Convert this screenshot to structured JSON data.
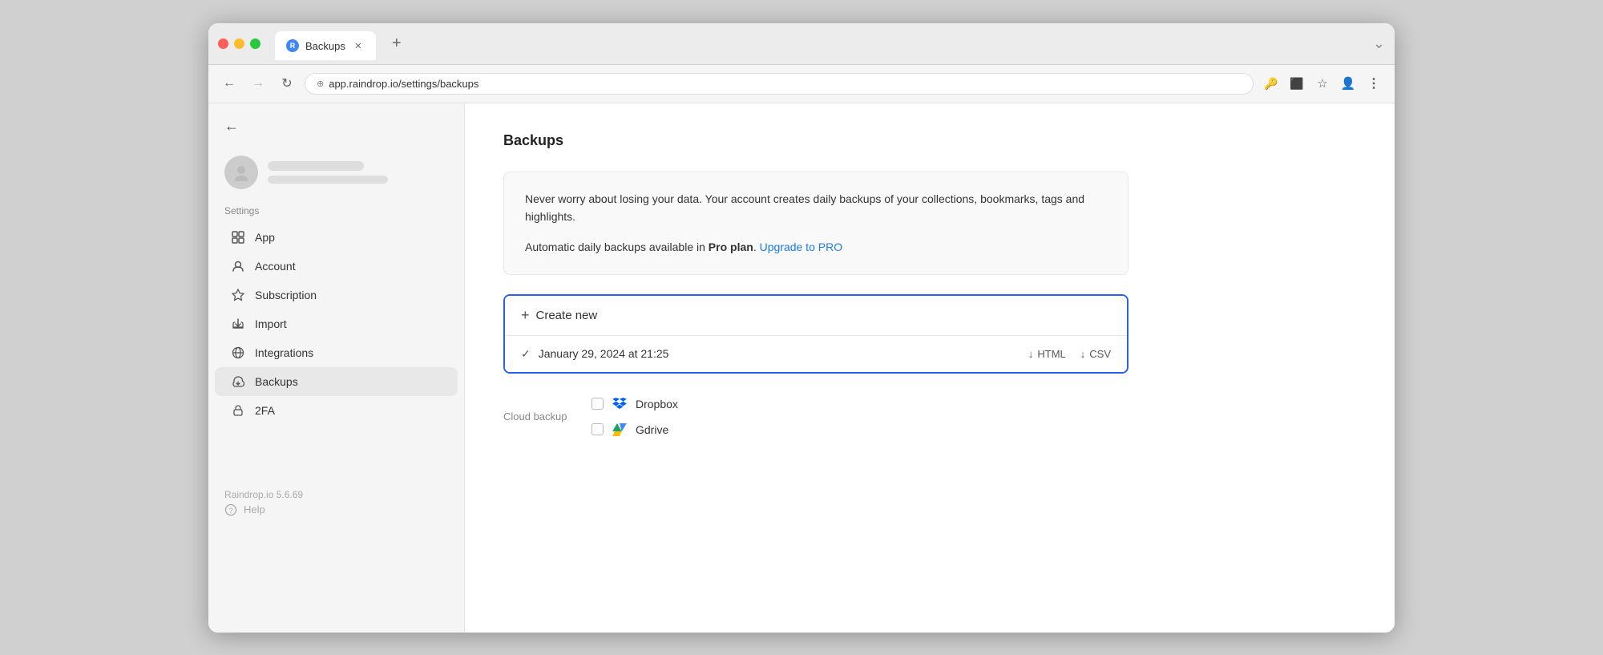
{
  "browser": {
    "tab_label": "Backups",
    "tab_favicon": "R",
    "url": "app.raindrop.io/settings/backups",
    "add_tab_label": "+",
    "chevron_down": "⌄"
  },
  "nav": {
    "back_arrow": "←",
    "forward_arrow": "→",
    "refresh": "↻"
  },
  "toolbar": {
    "keys_icon": "🔑",
    "cast_icon": "⬜",
    "star_icon": "☆",
    "profile_icon": "👤",
    "menu_icon": "⋮"
  },
  "sidebar": {
    "back_arrow": "←",
    "settings_label": "Settings",
    "items": [
      {
        "id": "app",
        "label": "App",
        "icon": "app"
      },
      {
        "id": "account",
        "label": "Account",
        "icon": "account"
      },
      {
        "id": "subscription",
        "label": "Subscription",
        "icon": "subscription"
      },
      {
        "id": "import",
        "label": "Import",
        "icon": "import"
      },
      {
        "id": "integrations",
        "label": "Integrations",
        "icon": "integrations"
      },
      {
        "id": "backups",
        "label": "Backups",
        "icon": "backups"
      },
      {
        "id": "2fa",
        "label": "2FA",
        "icon": "2fa"
      }
    ],
    "version": "Raindrop.io 5.6.69",
    "help_label": "Help"
  },
  "content": {
    "page_title": "Backups",
    "info_box": {
      "text1": "Never worry about losing your data. Your account creates daily backups of your collections, bookmarks, tags and highlights.",
      "text2_prefix": "Automatic daily backups available in ",
      "text2_bold": "Pro plan",
      "text2_suffix": ".",
      "upgrade_link": "Upgrade to PRO"
    },
    "create_new_label": "Create new",
    "create_new_icon": "+",
    "backup_item": {
      "date": "January 29, 2024 at 21:25",
      "html_label": "HTML",
      "csv_label": "CSV",
      "download_arrow": "↓"
    },
    "cloud_backup": {
      "label": "Cloud backup",
      "dropbox_label": "Dropbox",
      "gdrive_label": "Gdrive"
    }
  }
}
